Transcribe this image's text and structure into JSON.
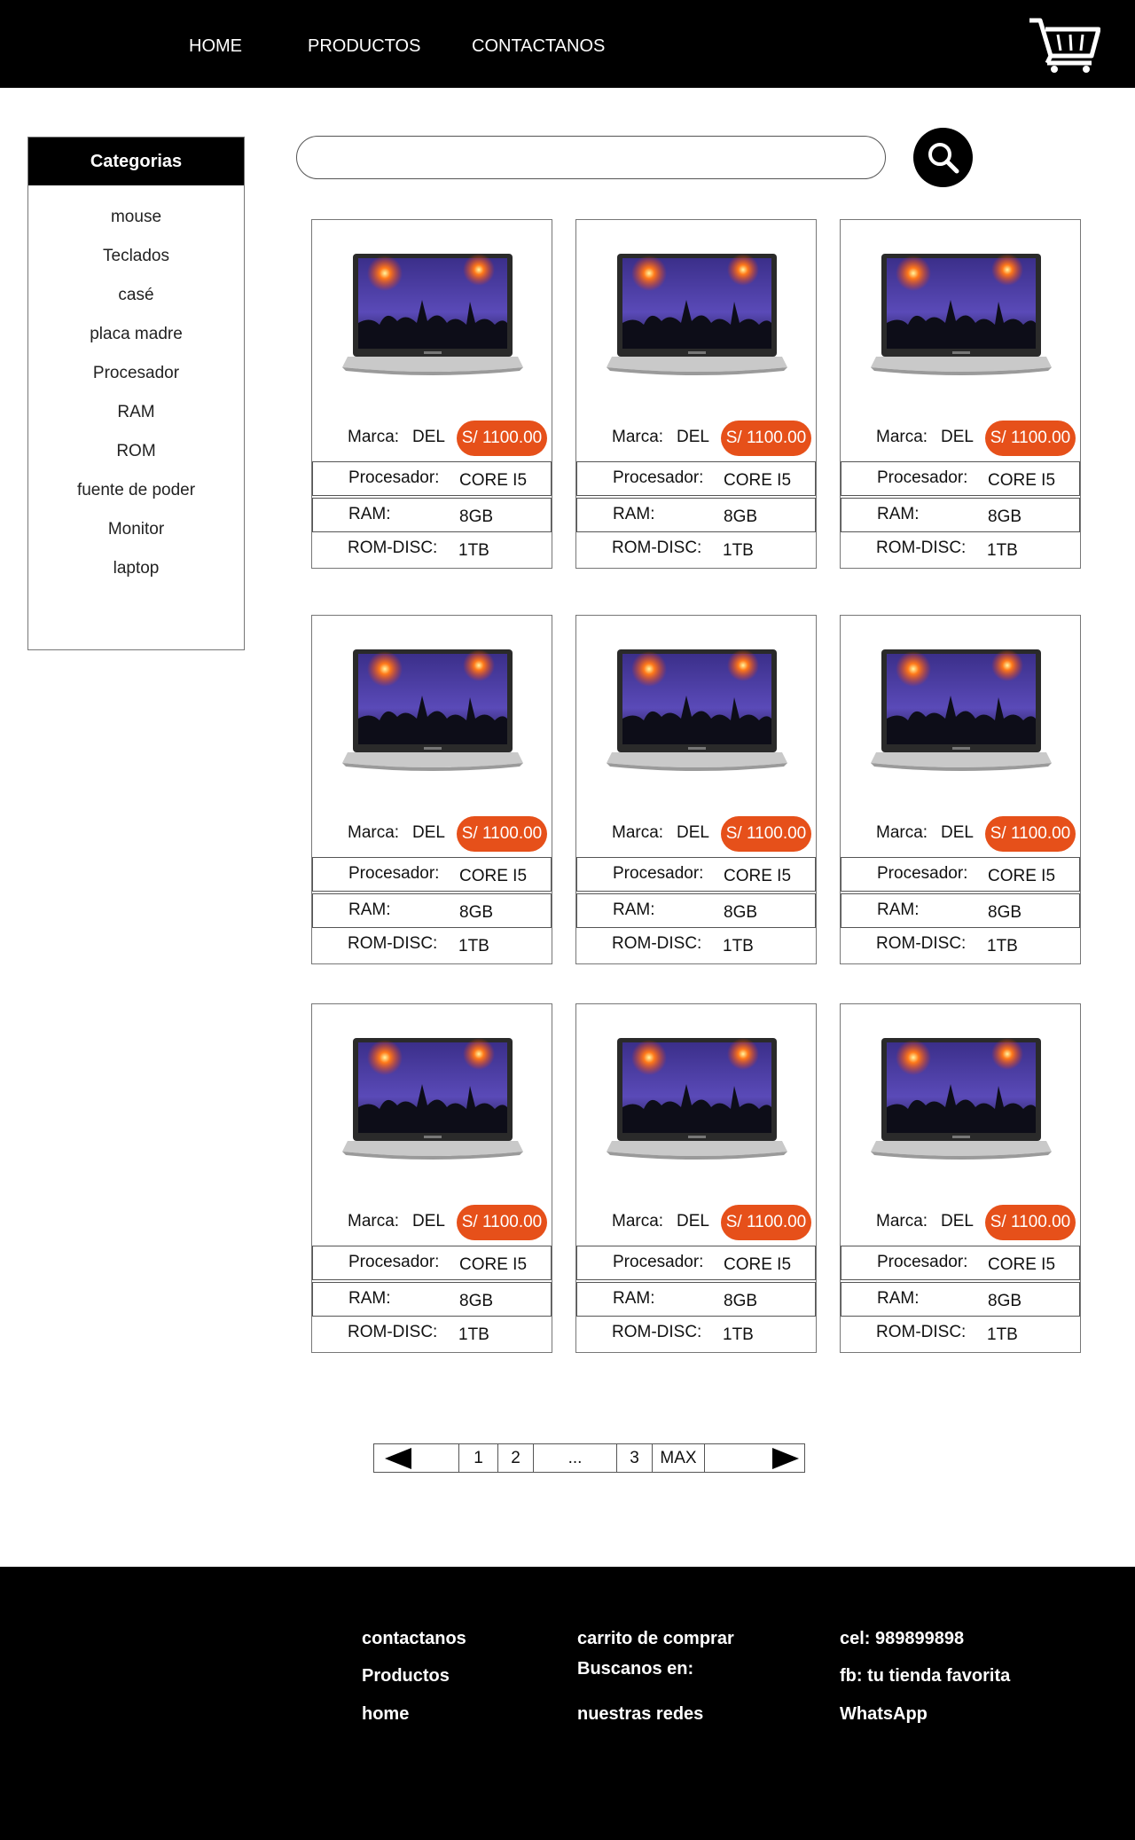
{
  "nav": {
    "items": [
      "HOME",
      "PRODUCTOS",
      "CONTACTANOS"
    ]
  },
  "cart": {
    "icon": "shopping-cart-icon"
  },
  "sidebar": {
    "title": "Categorias",
    "items": [
      "mouse",
      "Teclados",
      "casé",
      "placa madre",
      "Procesador",
      "RAM",
      "ROM",
      "fuente de poder",
      "Monitor",
      "laptop"
    ]
  },
  "search": {
    "value": "",
    "placeholder": "",
    "icon": "magnifier-icon"
  },
  "products": [
    {
      "brand_label": "Marca:",
      "brand": "DEL",
      "price": "S/ 1100.00",
      "processor_label": "Procesador:",
      "processor": "CORE I5",
      "ram_label": "RAM:",
      "ram": "8GB",
      "rom_label": "ROM-DISC:",
      "rom": "1TB"
    },
    {
      "brand_label": "Marca:",
      "brand": "DEL",
      "price": "S/ 1100.00",
      "processor_label": "Procesador:",
      "processor": "CORE I5",
      "ram_label": "RAM:",
      "ram": "8GB",
      "rom_label": "ROM-DISC:",
      "rom": "1TB"
    },
    {
      "brand_label": "Marca:",
      "brand": "DEL",
      "price": "S/ 1100.00",
      "processor_label": "Procesador:",
      "processor": "CORE I5",
      "ram_label": "RAM:",
      "ram": "8GB",
      "rom_label": "ROM-DISC:",
      "rom": "1TB"
    },
    {
      "brand_label": "Marca:",
      "brand": "DEL",
      "price": "S/ 1100.00",
      "processor_label": "Procesador:",
      "processor": "CORE I5",
      "ram_label": "RAM:",
      "ram": "8GB",
      "rom_label": "ROM-DISC:",
      "rom": "1TB"
    },
    {
      "brand_label": "Marca:",
      "brand": "DEL",
      "price": "S/ 1100.00",
      "processor_label": "Procesador:",
      "processor": "CORE I5",
      "ram_label": "RAM:",
      "ram": "8GB",
      "rom_label": "ROM-DISC:",
      "rom": "1TB"
    },
    {
      "brand_label": "Marca:",
      "brand": "DEL",
      "price": "S/ 1100.00",
      "processor_label": "Procesador:",
      "processor": "CORE I5",
      "ram_label": "RAM:",
      "ram": "8GB",
      "rom_label": "ROM-DISC:",
      "rom": "1TB"
    },
    {
      "brand_label": "Marca:",
      "brand": "DEL",
      "price": "S/ 1100.00",
      "processor_label": "Procesador:",
      "processor": "CORE I5",
      "ram_label": "RAM:",
      "ram": "8GB",
      "rom_label": "ROM-DISC:",
      "rom": "1TB"
    },
    {
      "brand_label": "Marca:",
      "brand": "DEL",
      "price": "S/ 1100.00",
      "processor_label": "Procesador:",
      "processor": "CORE I5",
      "ram_label": "RAM:",
      "ram": "8GB",
      "rom_label": "ROM-DISC:",
      "rom": "1TB"
    },
    {
      "brand_label": "Marca:",
      "brand": "DEL",
      "price": "S/ 1100.00",
      "processor_label": "Procesador:",
      "processor": "CORE I5",
      "ram_label": "RAM:",
      "ram": "8GB",
      "rom_label": "ROM-DISC:",
      "rom": "1TB"
    }
  ],
  "pagination": {
    "prev_icon": "left-triangle-icon",
    "next_icon": "right-triangle-icon",
    "pages": [
      "1",
      "2",
      "...",
      "3",
      "MAX"
    ]
  },
  "footer": {
    "col1": [
      "contactanos",
      "Productos",
      "home"
    ],
    "col2": [
      "carrito de comprar",
      "Buscanos en:",
      "nuestras redes"
    ],
    "col3": [
      "cel: 989899898",
      "fb: tu tienda favorita",
      "WhatsApp"
    ]
  },
  "colors": {
    "header_bg": "#000000",
    "price_badge": "#e6501a",
    "footer_bg": "#000000"
  }
}
